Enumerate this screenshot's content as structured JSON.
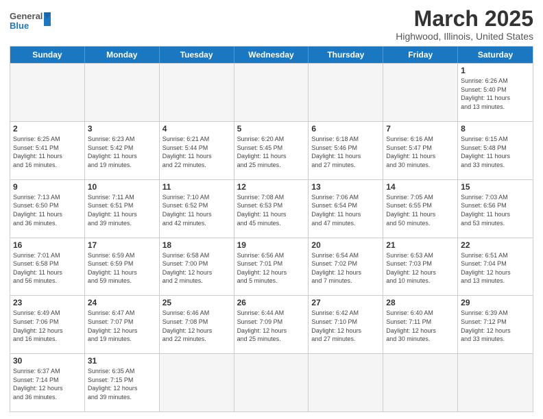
{
  "header": {
    "logo_general": "General",
    "logo_blue": "Blue",
    "month_title": "March 2025",
    "location": "Highwood, Illinois, United States"
  },
  "weekdays": [
    "Sunday",
    "Monday",
    "Tuesday",
    "Wednesday",
    "Thursday",
    "Friday",
    "Saturday"
  ],
  "weeks": [
    [
      {
        "day": "",
        "info": ""
      },
      {
        "day": "",
        "info": ""
      },
      {
        "day": "",
        "info": ""
      },
      {
        "day": "",
        "info": ""
      },
      {
        "day": "",
        "info": ""
      },
      {
        "day": "",
        "info": ""
      },
      {
        "day": "1",
        "info": "Sunrise: 6:26 AM\nSunset: 5:40 PM\nDaylight: 11 hours\nand 13 minutes."
      }
    ],
    [
      {
        "day": "2",
        "info": "Sunrise: 6:25 AM\nSunset: 5:41 PM\nDaylight: 11 hours\nand 16 minutes."
      },
      {
        "day": "3",
        "info": "Sunrise: 6:23 AM\nSunset: 5:42 PM\nDaylight: 11 hours\nand 19 minutes."
      },
      {
        "day": "4",
        "info": "Sunrise: 6:21 AM\nSunset: 5:44 PM\nDaylight: 11 hours\nand 22 minutes."
      },
      {
        "day": "5",
        "info": "Sunrise: 6:20 AM\nSunset: 5:45 PM\nDaylight: 11 hours\nand 25 minutes."
      },
      {
        "day": "6",
        "info": "Sunrise: 6:18 AM\nSunset: 5:46 PM\nDaylight: 11 hours\nand 27 minutes."
      },
      {
        "day": "7",
        "info": "Sunrise: 6:16 AM\nSunset: 5:47 PM\nDaylight: 11 hours\nand 30 minutes."
      },
      {
        "day": "8",
        "info": "Sunrise: 6:15 AM\nSunset: 5:48 PM\nDaylight: 11 hours\nand 33 minutes."
      }
    ],
    [
      {
        "day": "9",
        "info": "Sunrise: 7:13 AM\nSunset: 6:50 PM\nDaylight: 11 hours\nand 36 minutes."
      },
      {
        "day": "10",
        "info": "Sunrise: 7:11 AM\nSunset: 6:51 PM\nDaylight: 11 hours\nand 39 minutes."
      },
      {
        "day": "11",
        "info": "Sunrise: 7:10 AM\nSunset: 6:52 PM\nDaylight: 11 hours\nand 42 minutes."
      },
      {
        "day": "12",
        "info": "Sunrise: 7:08 AM\nSunset: 6:53 PM\nDaylight: 11 hours\nand 45 minutes."
      },
      {
        "day": "13",
        "info": "Sunrise: 7:06 AM\nSunset: 6:54 PM\nDaylight: 11 hours\nand 47 minutes."
      },
      {
        "day": "14",
        "info": "Sunrise: 7:05 AM\nSunset: 6:55 PM\nDaylight: 11 hours\nand 50 minutes."
      },
      {
        "day": "15",
        "info": "Sunrise: 7:03 AM\nSunset: 6:56 PM\nDaylight: 11 hours\nand 53 minutes."
      }
    ],
    [
      {
        "day": "16",
        "info": "Sunrise: 7:01 AM\nSunset: 6:58 PM\nDaylight: 11 hours\nand 56 minutes."
      },
      {
        "day": "17",
        "info": "Sunrise: 6:59 AM\nSunset: 6:59 PM\nDaylight: 11 hours\nand 59 minutes."
      },
      {
        "day": "18",
        "info": "Sunrise: 6:58 AM\nSunset: 7:00 PM\nDaylight: 12 hours\nand 2 minutes."
      },
      {
        "day": "19",
        "info": "Sunrise: 6:56 AM\nSunset: 7:01 PM\nDaylight: 12 hours\nand 5 minutes."
      },
      {
        "day": "20",
        "info": "Sunrise: 6:54 AM\nSunset: 7:02 PM\nDaylight: 12 hours\nand 7 minutes."
      },
      {
        "day": "21",
        "info": "Sunrise: 6:53 AM\nSunset: 7:03 PM\nDaylight: 12 hours\nand 10 minutes."
      },
      {
        "day": "22",
        "info": "Sunrise: 6:51 AM\nSunset: 7:04 PM\nDaylight: 12 hours\nand 13 minutes."
      }
    ],
    [
      {
        "day": "23",
        "info": "Sunrise: 6:49 AM\nSunset: 7:06 PM\nDaylight: 12 hours\nand 16 minutes."
      },
      {
        "day": "24",
        "info": "Sunrise: 6:47 AM\nSunset: 7:07 PM\nDaylight: 12 hours\nand 19 minutes."
      },
      {
        "day": "25",
        "info": "Sunrise: 6:46 AM\nSunset: 7:08 PM\nDaylight: 12 hours\nand 22 minutes."
      },
      {
        "day": "26",
        "info": "Sunrise: 6:44 AM\nSunset: 7:09 PM\nDaylight: 12 hours\nand 25 minutes."
      },
      {
        "day": "27",
        "info": "Sunrise: 6:42 AM\nSunset: 7:10 PM\nDaylight: 12 hours\nand 27 minutes."
      },
      {
        "day": "28",
        "info": "Sunrise: 6:40 AM\nSunset: 7:11 PM\nDaylight: 12 hours\nand 30 minutes."
      },
      {
        "day": "29",
        "info": "Sunrise: 6:39 AM\nSunset: 7:12 PM\nDaylight: 12 hours\nand 33 minutes."
      }
    ],
    [
      {
        "day": "30",
        "info": "Sunrise: 6:37 AM\nSunset: 7:14 PM\nDaylight: 12 hours\nand 36 minutes."
      },
      {
        "day": "31",
        "info": "Sunrise: 6:35 AM\nSunset: 7:15 PM\nDaylight: 12 hours\nand 39 minutes."
      },
      {
        "day": "",
        "info": ""
      },
      {
        "day": "",
        "info": ""
      },
      {
        "day": "",
        "info": ""
      },
      {
        "day": "",
        "info": ""
      },
      {
        "day": "",
        "info": ""
      }
    ]
  ]
}
